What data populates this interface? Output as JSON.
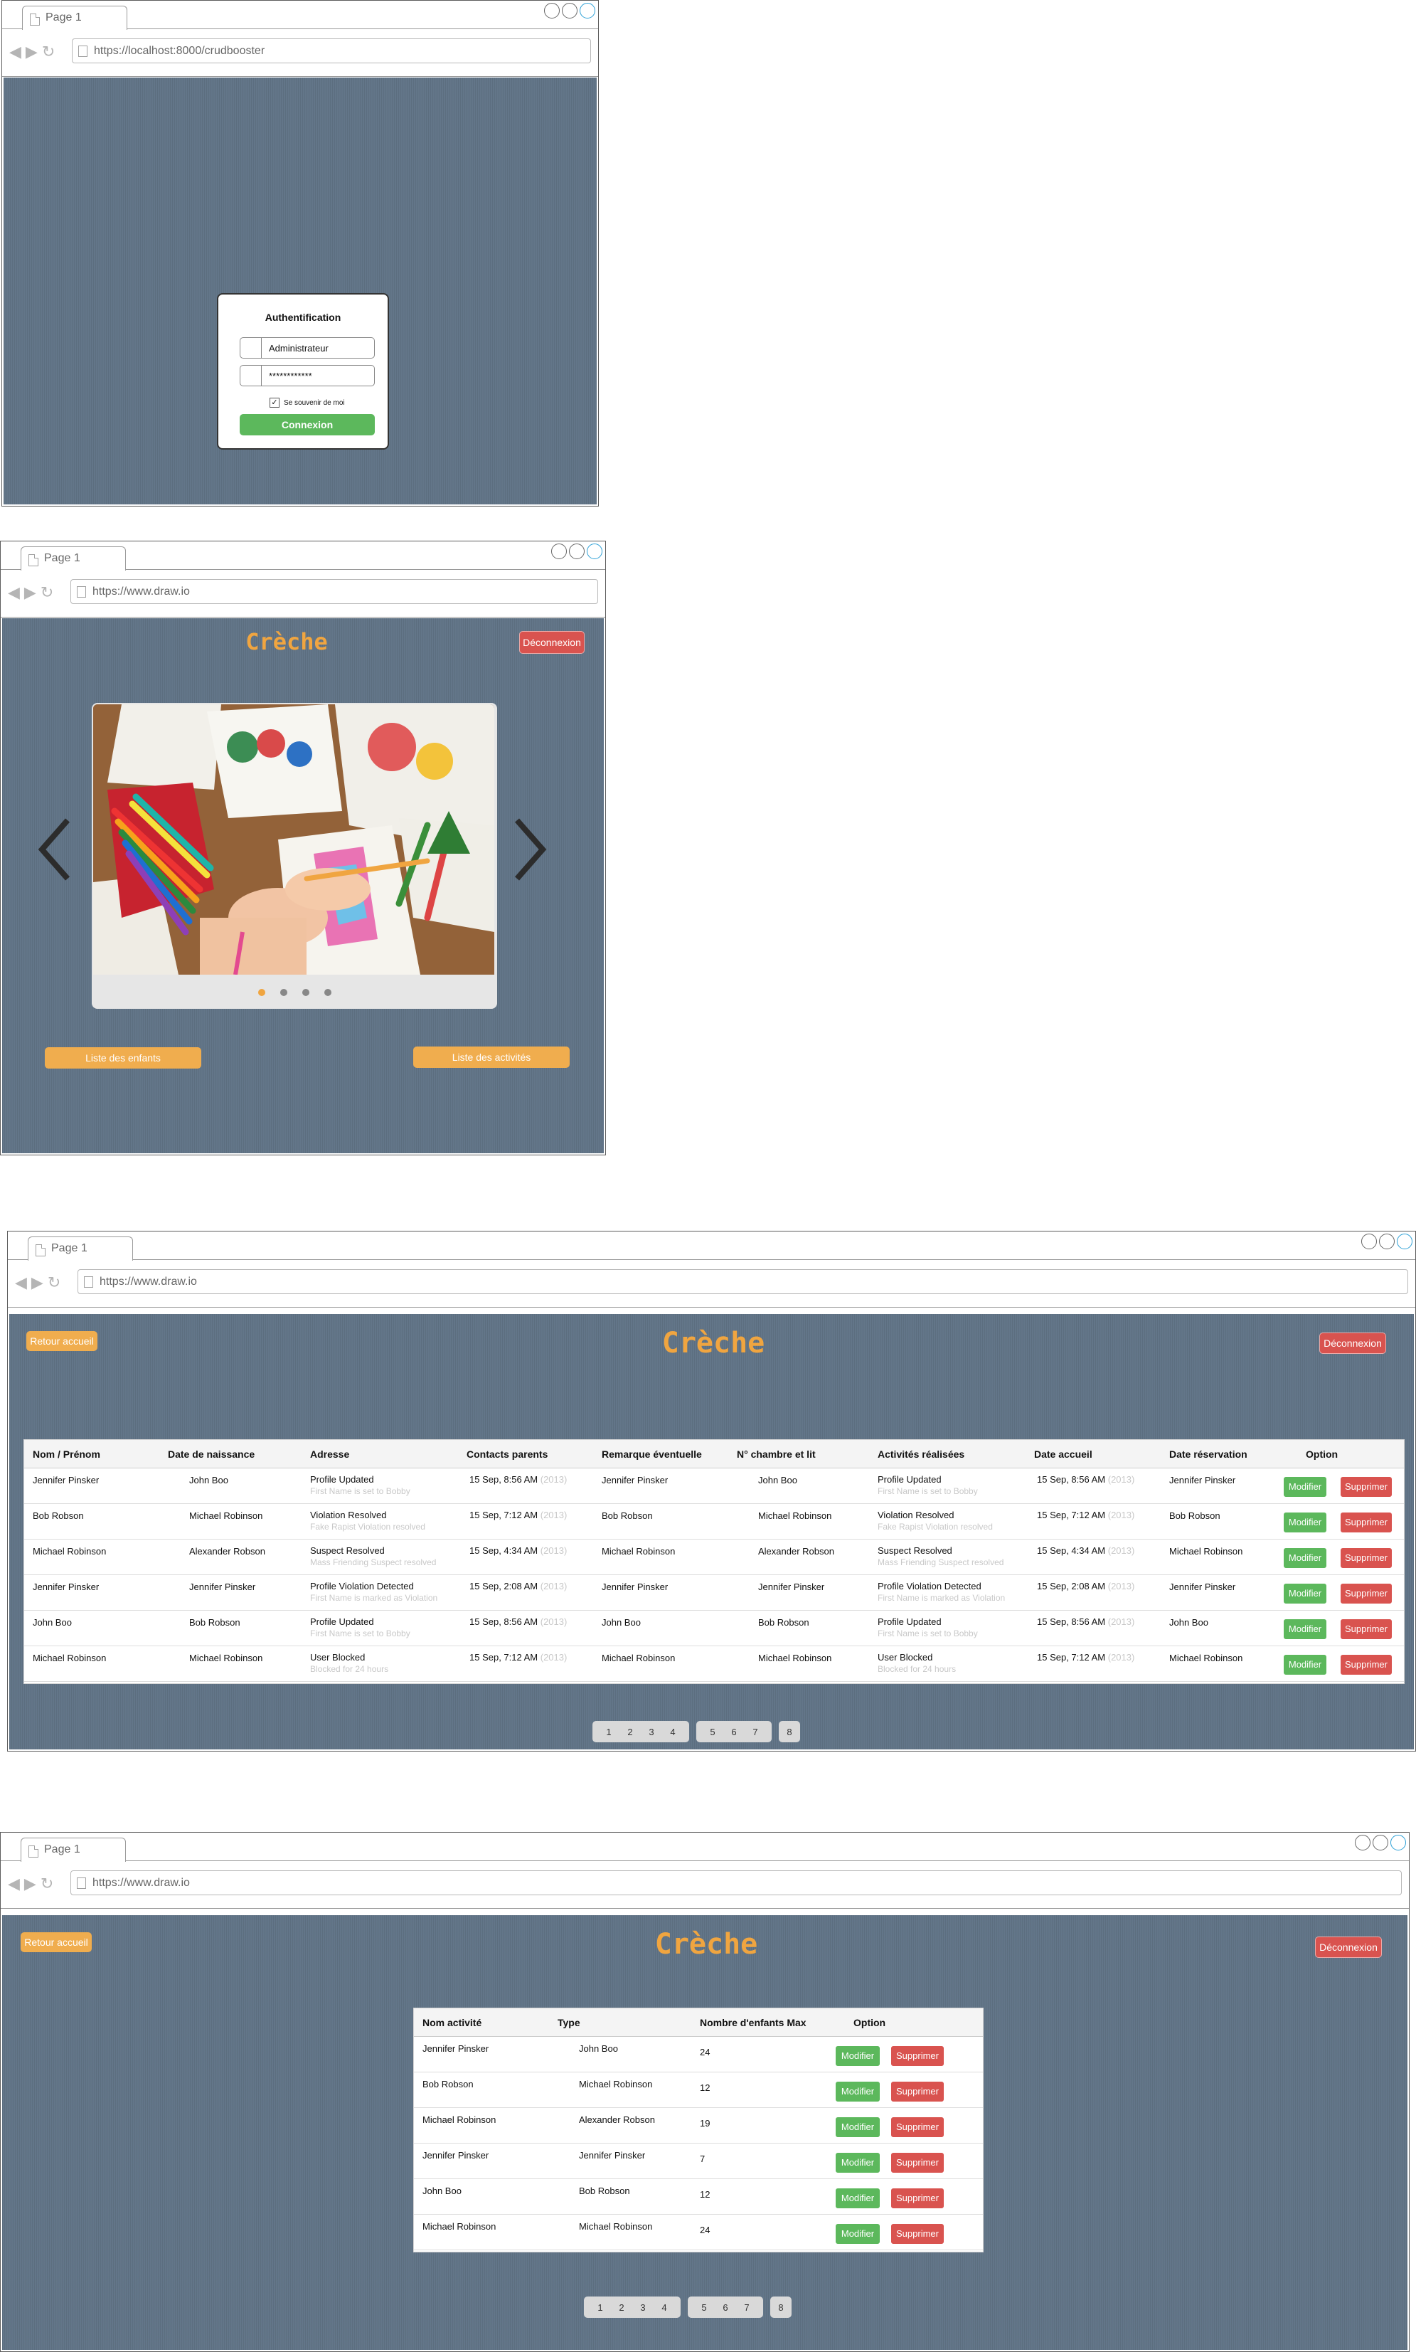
{
  "screens": {
    "login": {
      "tab": "Page 1",
      "url": "https://localhost:8000/crudbooster",
      "title": "Authentification",
      "username": "Administrateur",
      "password": "************",
      "remember_label": "Se souvenir de moi",
      "submit": "Connexion"
    },
    "home": {
      "tab": "Page 1",
      "url": "https://www.draw.io",
      "title": "Crèche",
      "logout": "Déconnexion",
      "btn_children": "Liste des enfants",
      "btn_activities": "Liste des activités",
      "slide_count": 4,
      "active_slide": 1
    },
    "children": {
      "tab": "Page 1",
      "url": "https://www.draw.io",
      "title": "Crèche",
      "back": "Retour accueil",
      "logout": "Déconnexion",
      "columns": [
        "Nom / Prénom",
        "Date de naissance",
        "Adresse",
        "Contacts parents",
        "Remarque éventuelle",
        "N° chambre et lit",
        "Activités réalisées",
        "Date accueil",
        "Date réservation",
        "Option"
      ],
      "rows": [
        {
          "name": "Jennifer Pinsker",
          "birth": "John Boo",
          "addr": "Profile Updated",
          "addr_sub": "First Name is set to Bobby",
          "contact": "15 Sep, 8:56 AM",
          "year": "(2013)",
          "remark": "Jennifer Pinsker",
          "room": "John Boo",
          "act": "Profile Updated",
          "act_sub": "First Name is set to Bobby",
          "date": "15 Sep, 8:56 AM",
          "resv": "Jennifer Pinsker"
        },
        {
          "name": "Bob Robson",
          "birth": "Michael Robinson",
          "addr": "Violation Resolved",
          "addr_sub": "Fake Rapist Violation resolved",
          "contact": "15 Sep, 7:12 AM",
          "year": "(2013)",
          "remark": "Bob Robson",
          "room": "Michael Robinson",
          "act": "Violation Resolved",
          "act_sub": "Fake Rapist Violation resolved",
          "date": "15 Sep, 7:12 AM",
          "resv": "Bob Robson"
        },
        {
          "name": "Michael Robinson",
          "birth": "Alexander Robson",
          "addr": "Suspect Resolved",
          "addr_sub": "Mass Friending Suspect resolved",
          "contact": "15 Sep, 4:34 AM",
          "year": "(2013)",
          "remark": "Michael Robinson",
          "room": "Alexander Robson",
          "act": "Suspect Resolved",
          "act_sub": "Mass Friending Suspect resolved",
          "date": "15 Sep, 4:34 AM",
          "resv": "Michael Robinson"
        },
        {
          "name": "Jennifer Pinsker",
          "birth": "Jennifer Pinsker",
          "addr": "Profile Violation Detected",
          "addr_sub": "First Name is marked as Violation",
          "contact": "15 Sep, 2:08 AM",
          "year": "(2013)",
          "remark": "Jennifer Pinsker",
          "room": "Jennifer Pinsker",
          "act": "Profile Violation Detected",
          "act_sub": "First Name is marked as Violation",
          "date": "15 Sep, 2:08 AM",
          "resv": "Jennifer Pinsker"
        },
        {
          "name": "John Boo",
          "birth": "Bob Robson",
          "addr": "Profile Updated",
          "addr_sub": "First Name is set to Bobby",
          "contact": "15 Sep, 8:56 AM",
          "year": "(2013)",
          "remark": "John Boo",
          "room": "Bob Robson",
          "act": "Profile Updated",
          "act_sub": "First Name is set to Bobby",
          "date": "15 Sep, 8:56 AM",
          "resv": "John Boo"
        },
        {
          "name": "Michael Robinson",
          "birth": "Michael Robinson",
          "addr": "User Blocked",
          "addr_sub": "Blocked for 24 hours",
          "contact": "15 Sep, 7:12 AM",
          "year": "(2013)",
          "remark": "Michael Robinson",
          "room": "Michael Robinson",
          "act": "User Blocked",
          "act_sub": "Blocked for 24 hours",
          "date": "15 Sep, 7:12 AM",
          "resv": "Michael Robinson"
        }
      ],
      "edit": "Modifier",
      "delete": "Supprimer",
      "pages": [
        [
          "1",
          "2",
          "3",
          "4"
        ],
        [
          "5",
          "6",
          "7"
        ],
        [
          "8"
        ]
      ]
    },
    "activities": {
      "tab": "Page 1",
      "url": "https://www.draw.io",
      "title": "Crèche",
      "back": "Retour accueil",
      "logout": "Déconnexion",
      "columns": [
        "Nom activité",
        "Type",
        "Nombre d'enfants Max",
        "Option"
      ],
      "rows": [
        {
          "name": "Jennifer Pinsker",
          "type": "John Boo",
          "max": "24"
        },
        {
          "name": "Bob Robson",
          "type": "Michael Robinson",
          "max": "12"
        },
        {
          "name": "Michael Robinson",
          "type": "Alexander Robson",
          "max": "19"
        },
        {
          "name": "Jennifer Pinsker",
          "type": "Jennifer Pinsker",
          "max": "7"
        },
        {
          "name": "John Boo",
          "type": "Bob Robson",
          "max": "12"
        },
        {
          "name": "Michael Robinson",
          "type": "Michael Robinson",
          "max": "24"
        }
      ],
      "edit": "Modifier",
      "delete": "Supprimer",
      "pages": [
        [
          "1",
          "2",
          "3",
          "4"
        ],
        [
          "5",
          "6",
          "7"
        ],
        [
          "8"
        ]
      ]
    }
  },
  "colors": {
    "background": "#637689",
    "accent": "#f0a540",
    "danger": "#d9534f",
    "success": "#5cb85c"
  }
}
